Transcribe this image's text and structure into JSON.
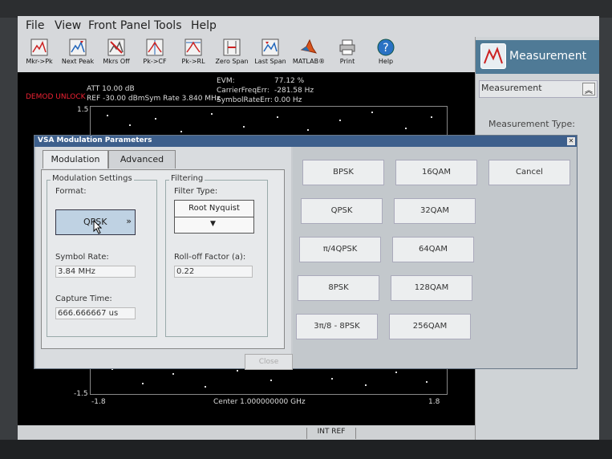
{
  "menu": [
    "File",
    "View",
    "Front Panel",
    "Tools",
    "Help"
  ],
  "toolbar": [
    {
      "label": "Mkr->Pk",
      "icon": "marker-peak-icon"
    },
    {
      "label": "Next Peak",
      "icon": "next-peak-icon"
    },
    {
      "label": "Mkrs Off",
      "icon": "markers-off-icon"
    },
    {
      "label": "Pk->CF",
      "icon": "peak-to-cf-icon"
    },
    {
      "label": "Pk->RL",
      "icon": "peak-to-rl-icon"
    },
    {
      "label": "Zero Span",
      "icon": "zero-span-icon"
    },
    {
      "label": "Last Span",
      "icon": "last-span-icon"
    },
    {
      "label": "MATLAB®",
      "icon": "matlab-icon"
    },
    {
      "label": "Print",
      "icon": "printer-icon"
    },
    {
      "label": "Help",
      "icon": "help-icon"
    }
  ],
  "measurement_panel": {
    "title": "Measurement",
    "section": "Measurement",
    "type_label": "Measurement Type:"
  },
  "analyzer": {
    "demod_status": "DEMOD UNLOCK",
    "att": "ATT 10.00 dB",
    "ref": "REF -30.00 dBmSym Rate 3.840 MHz",
    "evm_label": "EVM:",
    "evm_value": "77.12 %",
    "carrier_label": "CarrierFreqErr:",
    "carrier_value": "-281.58 Hz",
    "symbol_label": "SymbolRateErr:",
    "symbol_value": "0.00 Hz",
    "y_top": "1.5",
    "y_bottom": "-1.5",
    "x_left": "-1.8",
    "x_right": "1.8",
    "center": "Center 1.000000000 GHz",
    "int_ref": "INT REF"
  },
  "dialog": {
    "title": "VSA Modulation Parameters",
    "close_x": "✕",
    "tabs": [
      "Modulation",
      "Advanced"
    ],
    "mod_settings_label": "Modulation Settings",
    "format_label": "Format:",
    "format_value": "QPSK",
    "format_chevron": "»",
    "symbol_rate_label": "Symbol Rate:",
    "symbol_rate_value": "3.84 MHz",
    "capture_time_label": "Capture Time:",
    "capture_time_value": "666.666667 us",
    "filtering_label": "Filtering",
    "filter_type_label": "Filter Type:",
    "filter_type_value": "Root Nyquist",
    "filter_arrow": "▼",
    "rolloff_label": "Roll-off Factor (a):",
    "rolloff_value": "0.22",
    "close_button": "Close",
    "mod_buttons": [
      "BPSK",
      "16QAM",
      "Cancel",
      "QPSK",
      "32QAM",
      "π/4QPSK",
      "64QAM",
      "8PSK",
      "128QAM",
      "3π/8 - 8PSK",
      "256QAM"
    ]
  }
}
